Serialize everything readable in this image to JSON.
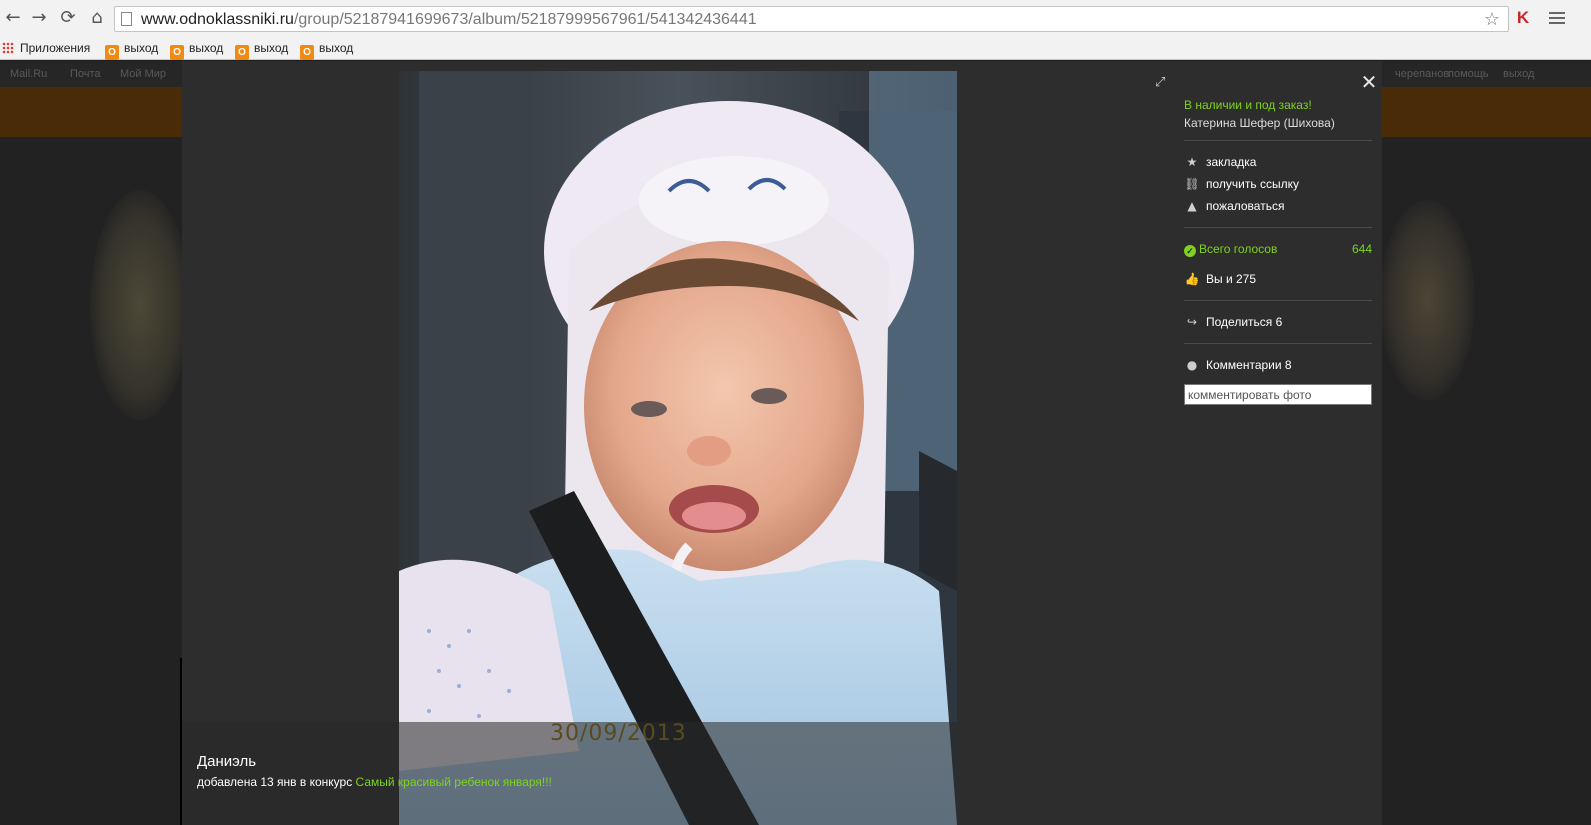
{
  "browser": {
    "url_host": "www.odnoklassniki.ru",
    "url_path": "/group/52187941699673/album/52187999567961/541342436441",
    "bookmarks": {
      "apps_label": "Приложения",
      "items": [
        "выход",
        "выход",
        "выход",
        "выход"
      ]
    }
  },
  "site": {
    "topbar_links": [
      "Mail.Ru",
      "Почта",
      "Мой Мир"
    ],
    "topbar_right": [
      "черепанов",
      "помощь",
      "выход"
    ]
  },
  "photo": {
    "date_stamp": "30/09/2013",
    "title": "Даниэль",
    "added_text": "добавлена 13 янв в конкурс",
    "contest_link": "Самый красивый ребенок января!!!"
  },
  "panel": {
    "group_name": "В наличии и под заказ!",
    "author": "Катерина Шефер (Шихова)",
    "actions": {
      "bookmark": "закладка",
      "get_link": "получить ссылку",
      "report": "пожаловаться"
    },
    "votes_label": "Всего голосов",
    "votes_count": "644",
    "likes": "Вы и 275",
    "share": "Поделиться 6",
    "comments": "Комментарии 8",
    "comment_placeholder": "комментировать фото"
  },
  "colors": {
    "accent_green": "#7ed321",
    "overlay_bg": "#2d2d2d",
    "odnoklassniki_orange": "#ef8a12"
  }
}
